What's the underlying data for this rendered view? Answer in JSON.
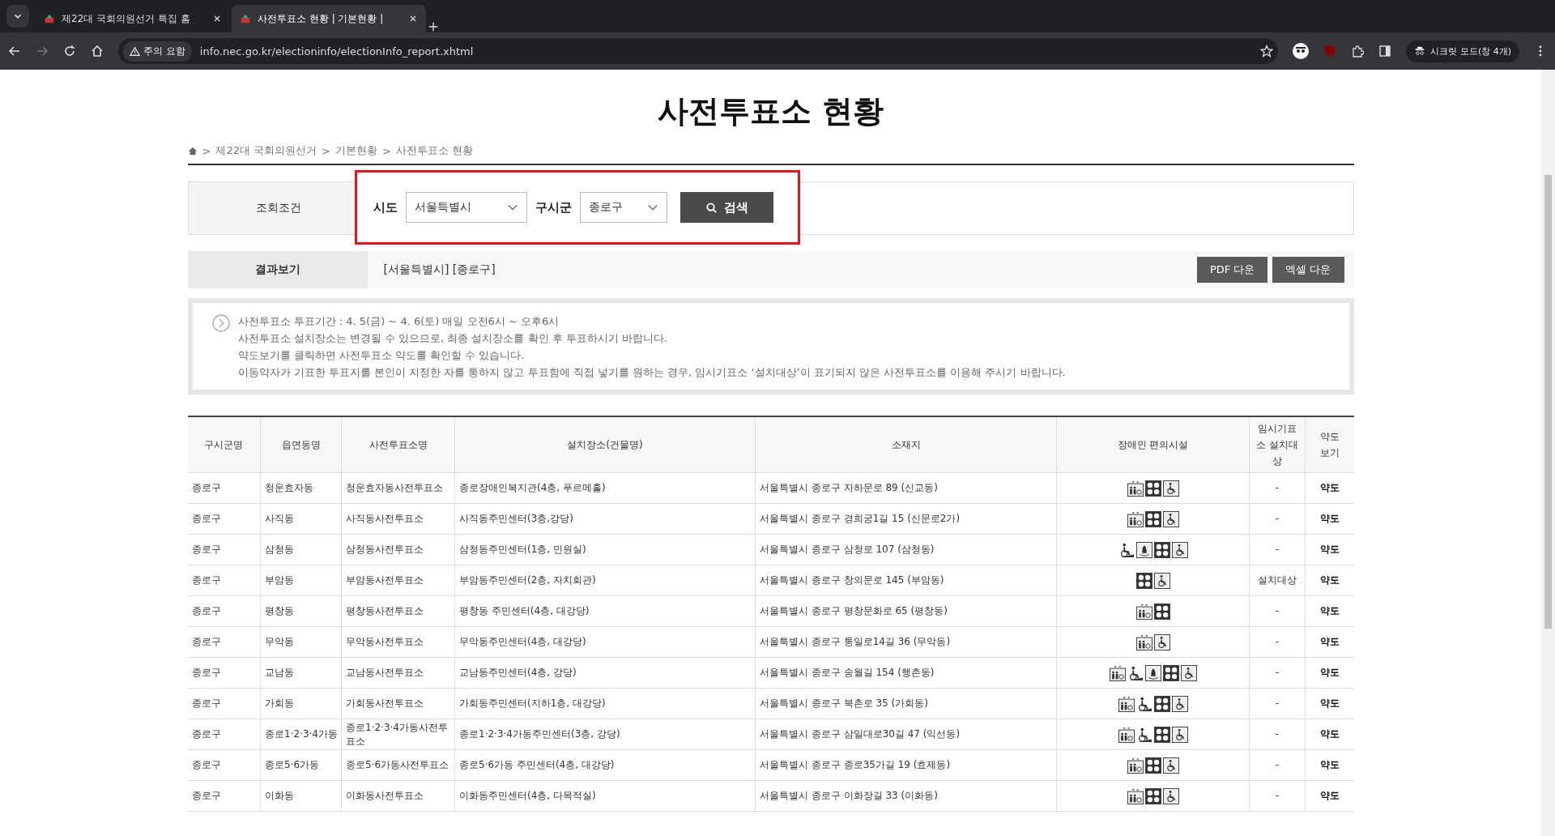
{
  "browser": {
    "tabs": [
      {
        "title": "제22대 국회의원선거 특집 홈",
        "selected": false
      },
      {
        "title": "사전투표소 현황 | 기본현황 |",
        "selected": true
      }
    ],
    "security_chip": "주의 요함",
    "url": "info.nec.go.kr/electioninfo/electionInfo_report.xhtml",
    "profile_label": "시크릿 모드(창 4개)"
  },
  "page": {
    "title": "사전투표소 현황",
    "separator": ">",
    "breadcrumb": [
      "제22대 국회의원선거",
      "기본현황",
      "사전투표소 현황"
    ]
  },
  "search": {
    "label": "조회조건",
    "fields": [
      {
        "label": "시도",
        "value": "서울특별시"
      },
      {
        "label": "구시군",
        "value": "종로구"
      }
    ],
    "button": "검색"
  },
  "result": {
    "label": "결과보기",
    "summary": "[서울특별시] [종로구]",
    "buttons": [
      "PDF 다운",
      "엑셀 다운"
    ]
  },
  "notice": [
    "사전투표소 투표기간 : 4. 5(금) ~ 4. 6(토) 매일 오전6시 ~ 오후6시",
    "사전투표소 설치장소는 변경될 수 있으므로, 최종 설치장소를 확인 후 투표하시기 바랍니다.",
    "약도보기를 클릭하면 사전투표소 약도를 확인할 수 있습니다.",
    "이동약자가 기표한 투표지를 본인이 지정한 자를 통하지 않고 투표함에 직접 넣기를 원하는 경우, 임시기표소 ‘설치대상’이 표기되지 않은 사전투표소를 이용해 주시기 바랍니다."
  ],
  "table": {
    "columns": [
      "구시군명",
      "읍면동명",
      "사전투표소명",
      "설치장소(건물명)",
      "소재지",
      "장애인 편의시설",
      "임시기표소 설치대상",
      "약도 보기"
    ],
    "rows": [
      {
        "cells": [
          "종로구",
          "청운효자동",
          "청운효자동사전투표소",
          "종로장애인복지관(4층, 푸르메홀)",
          "서울특별시 종로구 자하문로 89 (신교동)"
        ],
        "facilities": [
          {
            "kind": "elevator"
          },
          {
            "kind": "braille"
          },
          {
            "kind": "wheelchair"
          }
        ],
        "temporary": "-",
        "map": "약도"
      },
      {
        "cells": [
          "종로구",
          "사직동",
          "사직동사전투표소",
          "사직동주민센터(3층,강당)",
          "서울특별시 종로구 경희궁1길 15 (신문로2가)"
        ],
        "facilities": [
          {
            "kind": "elevator"
          },
          {
            "kind": "braille"
          },
          {
            "kind": "wheelchair"
          }
        ],
        "temporary": "-",
        "map": "약도"
      },
      {
        "cells": [
          "종로구",
          "삼청동",
          "삼청동사전투표소",
          "삼청동주민센터(1층, 민원실)",
          "서울특별시 종로구 삼청로 107 (삼청동)"
        ],
        "facilities": [
          {
            "kind": "ramp"
          },
          {
            "kind": "bell"
          },
          {
            "kind": "braille"
          },
          {
            "kind": "wheelchair"
          }
        ],
        "temporary": "-",
        "map": "약도"
      },
      {
        "cells": [
          "종로구",
          "부암동",
          "부암동사전투표소",
          "부암동주민센터(2층, 자치회관)",
          "서울특별시 종로구 창의문로 145 (부암동)"
        ],
        "facilities": [
          {
            "kind": "braille"
          },
          {
            "kind": "wheelchair"
          }
        ],
        "temporary": "설치대상",
        "map": "약도"
      },
      {
        "cells": [
          "종로구",
          "평창동",
          "평창동사전투표소",
          "평창동 주민센터(4층, 대강당)",
          "서울특별시 종로구 평창문화로 65 (평창동)"
        ],
        "facilities": [
          {
            "kind": "elevator"
          },
          {
            "kind": "braille"
          }
        ],
        "temporary": "-",
        "map": "약도"
      },
      {
        "cells": [
          "종로구",
          "무악동",
          "무악동사전투표소",
          "무악동주민센터(4층, 대강당)",
          "서울특별시 종로구 통일로14길 36 (무악동)"
        ],
        "facilities": [
          {
            "kind": "elevator"
          },
          {
            "kind": "wheelchair"
          }
        ],
        "temporary": "-",
        "map": "약도"
      },
      {
        "cells": [
          "종로구",
          "교남동",
          "교남동사전투표소",
          "교남동주민센터(4층, 강당)",
          "서울특별시 종로구 송월길 154 (행촌동)"
        ],
        "facilities": [
          {
            "kind": "elevator"
          },
          {
            "kind": "ramp"
          },
          {
            "kind": "bell"
          },
          {
            "kind": "braille"
          },
          {
            "kind": "wheelchair"
          }
        ],
        "temporary": "-",
        "map": "약도"
      },
      {
        "cells": [
          "종로구",
          "가회동",
          "가회동사전투표소",
          "가회동주민센터(지하1층, 대강당)",
          "서울특별시 종로구 북촌로 35 (가회동)"
        ],
        "facilities": [
          {
            "kind": "elevator"
          },
          {
            "kind": "ramp"
          },
          {
            "kind": "braille"
          },
          {
            "kind": "wheelchair"
          }
        ],
        "temporary": "-",
        "map": "약도"
      },
      {
        "cells": [
          "종로구",
          "종로1·2·3·4가동",
          "종로1·2·3·4가동사전투표소",
          "종로1·2·3·4가동주민센터(3층, 강당)",
          "서울특별시 종로구 삼일대로30길 47 (익선동)"
        ],
        "facilities": [
          {
            "kind": "elevator"
          },
          {
            "kind": "ramp"
          },
          {
            "kind": "braille"
          },
          {
            "kind": "wheelchair"
          }
        ],
        "temporary": "-",
        "map": "약도"
      },
      {
        "cells": [
          "종로구",
          "종로5·6가동",
          "종로5·6가동사전투표소",
          "종로5·6가동 주민센터(4층, 대강당)",
          "서울특별시 종로구 종로35가길 19 (효제동)"
        ],
        "facilities": [
          {
            "kind": "elevator"
          },
          {
            "kind": "braille"
          },
          {
            "kind": "wheelchair"
          }
        ],
        "temporary": "-",
        "map": "약도"
      },
      {
        "cells": [
          "종로구",
          "이화동",
          "이화동사전투표소",
          "이화동주민센터(4층, 다목적실)",
          "서울특별시 종로구 이화장길 33 (이화동)"
        ],
        "facilities": [
          {
            "kind": "elevator"
          },
          {
            "kind": "braille"
          },
          {
            "kind": "wheelchair"
          }
        ],
        "temporary": "-",
        "map": "약도"
      }
    ]
  }
}
